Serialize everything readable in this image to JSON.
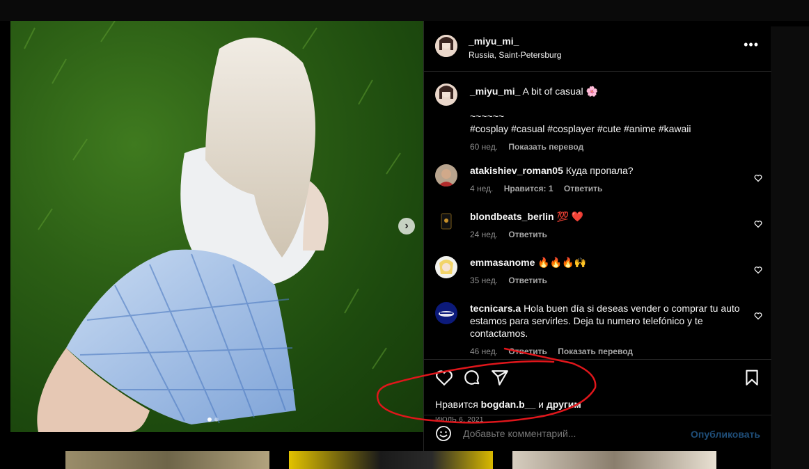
{
  "post": {
    "author": "_miyu_mi_",
    "location": "Russia, Saint-Petersburg",
    "caption_username": "_miyu_mi_",
    "caption_text": "A bit of casual 🌸",
    "caption_line2": "~~~~~~",
    "caption_tags": "#cosplay #casual #cosplayer #cute #anime #kawaii",
    "caption_time": "60 нед.",
    "caption_translate": "Показать перевод"
  },
  "comments": [
    {
      "user": "atakishiev_roman05",
      "text": "Куда пропала?",
      "time": "4 нед.",
      "likes": "Нравится: 1",
      "reply": "Ответить"
    },
    {
      "user": "blondbeats_berlin",
      "text": "💯 ❤️",
      "time": "24 нед.",
      "reply": "Ответить"
    },
    {
      "user": "emmasanome",
      "text": "🔥🔥🔥🙌",
      "time": "35 нед.",
      "reply": "Ответить"
    },
    {
      "user": "tecnicars.a",
      "text": "Hola buen día si deseas vender o comprar tu auto estamos para servirles. Deja tu numero telefónico y te contactamos.",
      "time": "46 нед.",
      "reply": "Ответить",
      "translate": "Показать перевод"
    }
  ],
  "likes": {
    "prefix": "Нравится",
    "user": "bogdan.b__",
    "and": "и",
    "others": "другим"
  },
  "date": "ИЮЛЬ 6, 2021",
  "add_comment": {
    "placeholder": "Добавьте комментарий...",
    "publish": "Опубликовать"
  },
  "colors": {
    "background": "#000000",
    "border": "#262626",
    "muted": "#8e8e8e",
    "publish_disabled": "#1f4e79",
    "annotation": "#e0161b"
  },
  "icons": [
    "more-icon",
    "heart-icon",
    "comment-icon",
    "share-icon",
    "bookmark-icon",
    "emoji-icon",
    "next-arrow-icon"
  ]
}
